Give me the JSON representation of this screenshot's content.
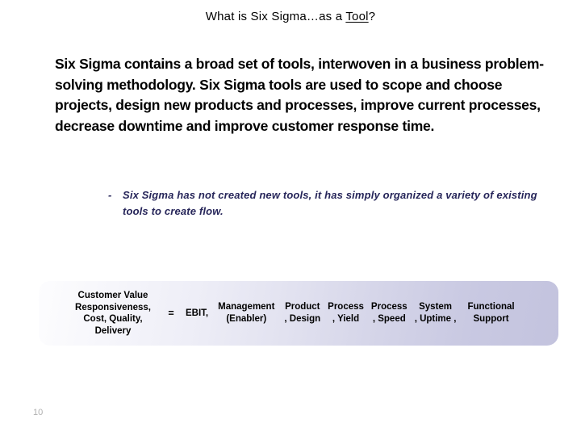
{
  "slide": {
    "title_prefix": "What is Six Sigma…as a ",
    "title_underlined": "Tool",
    "title_suffix": "?",
    "page_number": "10"
  },
  "body": {
    "paragraph": "Six Sigma contains a broad set of tools, interwoven in a business problem-solving methodology. Six Sigma tools are used to scope and choose projects, design new products and processes, improve current processes, decrease downtime and improve customer response time."
  },
  "sub_bullet": {
    "dash": "-",
    "text": "Six Sigma has not created new tools, it has simply organized a variety of existing tools to create flow."
  },
  "equation": {
    "lhs_lines": [
      "Customer Value",
      "Responsiveness,",
      "Cost, Quality,",
      "Delivery"
    ],
    "equals": "=",
    "first_term": "EBIT,",
    "terms": [
      {
        "top": "Management",
        "bottom": "(Enabler)"
      },
      {
        "top": "Product",
        "bottom": ", Design"
      },
      {
        "top": "Process",
        "bottom": ", Yield"
      },
      {
        "top": "Process",
        "bottom": ", Speed"
      },
      {
        "top": "System",
        "bottom": ", Uptime ,"
      },
      {
        "top": "Functional",
        "bottom": "Support"
      }
    ]
  },
  "colors": {
    "title_text": "#000000",
    "body_text": "#000000",
    "sub_bullet_text": "#27265a",
    "bar_gradient_start": "#fdfdfe",
    "bar_gradient_end": "#c3c3de",
    "page_number": "#b0b0b0",
    "background": "#ffffff"
  }
}
